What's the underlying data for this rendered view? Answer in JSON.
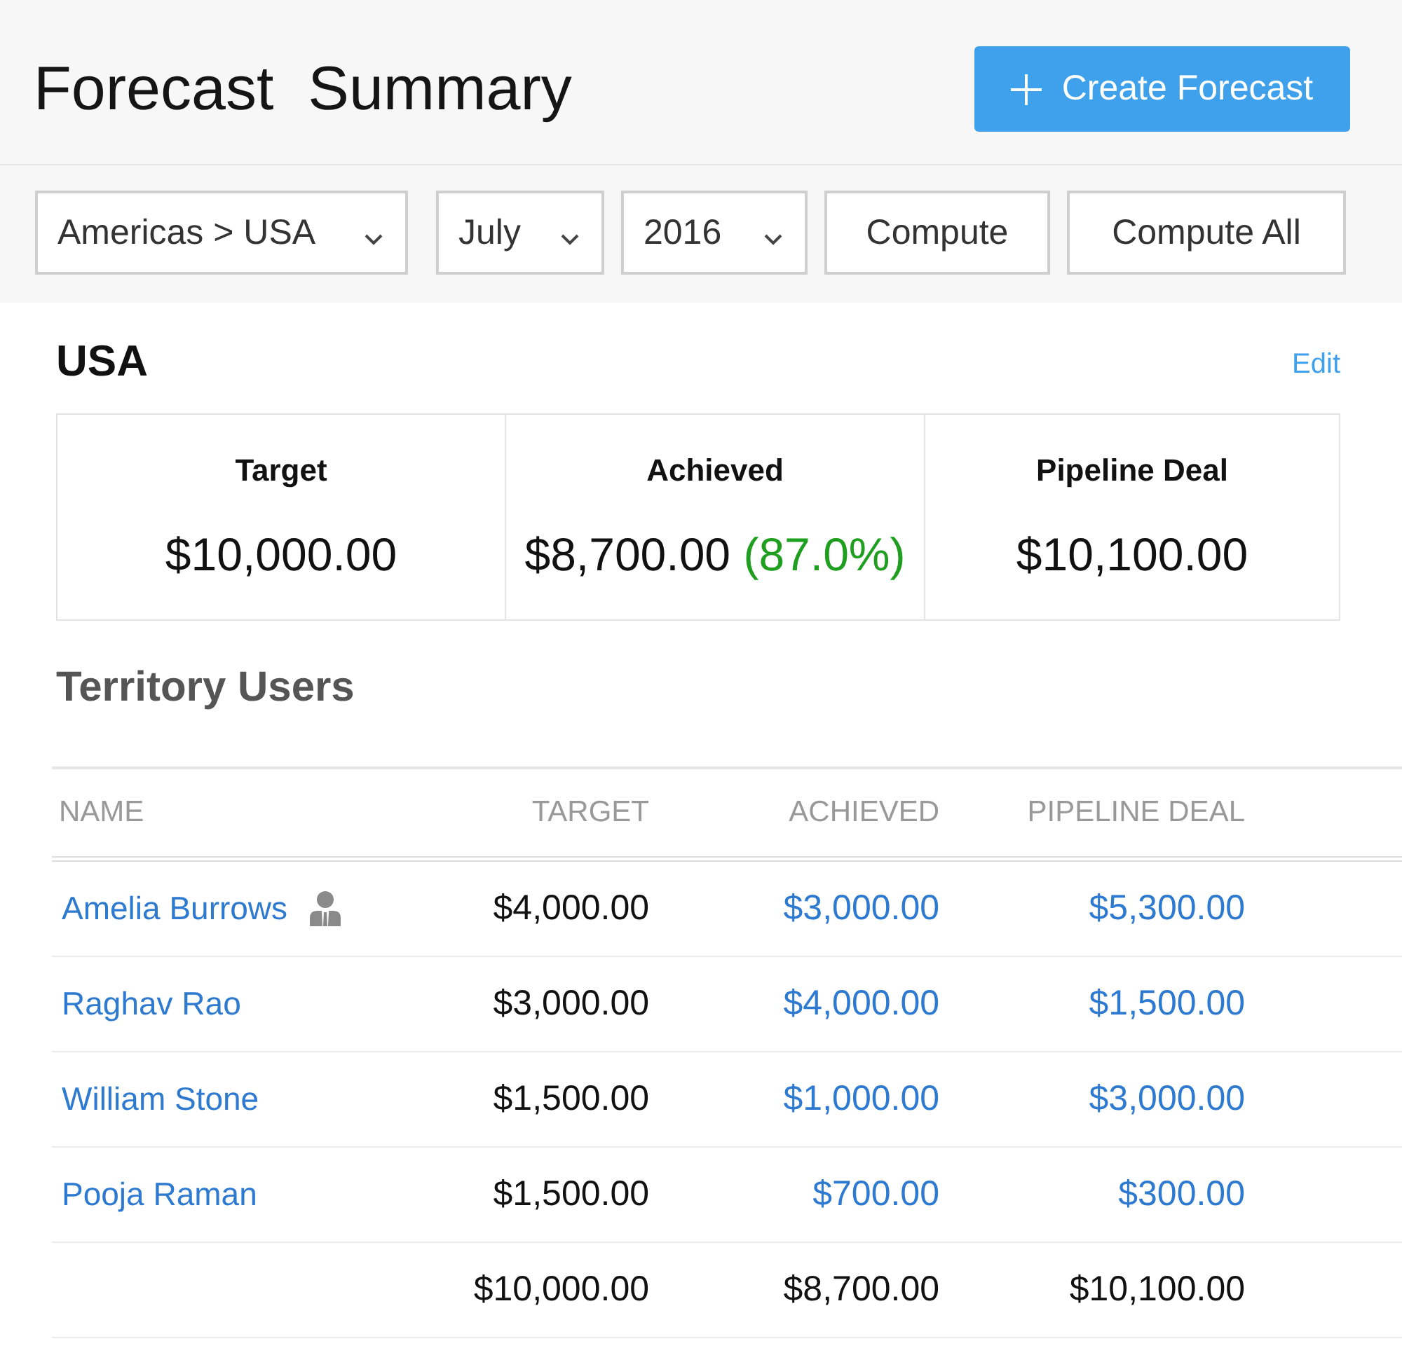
{
  "header": {
    "title": "Forecast  Summary",
    "create_button": {
      "label": "Create Forecast"
    }
  },
  "filters": [
    {
      "kind": "dropdown",
      "value": "Americas > USA"
    },
    {
      "kind": "dropdown",
      "value": "July"
    },
    {
      "kind": "dropdown",
      "value": "2016"
    },
    {
      "kind": "button",
      "label": "Compute"
    },
    {
      "kind": "button",
      "label": "Compute All"
    }
  ],
  "territory": {
    "name": "USA",
    "edit_link": "Edit",
    "summary": [
      {
        "label": "Target",
        "value": "$10,000.00"
      },
      {
        "label": "Achieved",
        "value": "$8,700.00",
        "percent": "(87.0%)"
      },
      {
        "label": "Pipeline Deal",
        "value": "$10,100.00"
      }
    ]
  },
  "users_section": {
    "title": "Territory Users",
    "columns": [
      "NAME",
      "TARGET",
      "ACHIEVED",
      "PIPELINE DEAL"
    ],
    "rows": [
      {
        "name": "Amelia Burrows",
        "manager": true,
        "target": "$4,000.00",
        "achieved": "$3,000.00",
        "pipeline_deal": "$5,300.00"
      },
      {
        "name": "Raghav Rao",
        "manager": false,
        "target": "$3,000.00",
        "achieved": "$4,000.00",
        "pipeline_deal": "$1,500.00"
      },
      {
        "name": "William Stone",
        "manager": false,
        "target": "$1,500.00",
        "achieved": "$1,000.00",
        "pipeline_deal": "$3,000.00"
      },
      {
        "name": "Pooja Raman",
        "manager": false,
        "target": "$1,500.00",
        "achieved": "$700.00",
        "pipeline_deal": "$300.00"
      }
    ],
    "totals": {
      "target": "$10,000.00",
      "achieved": "$8,700.00",
      "pipeline_deal": "$10,100.00"
    }
  }
}
